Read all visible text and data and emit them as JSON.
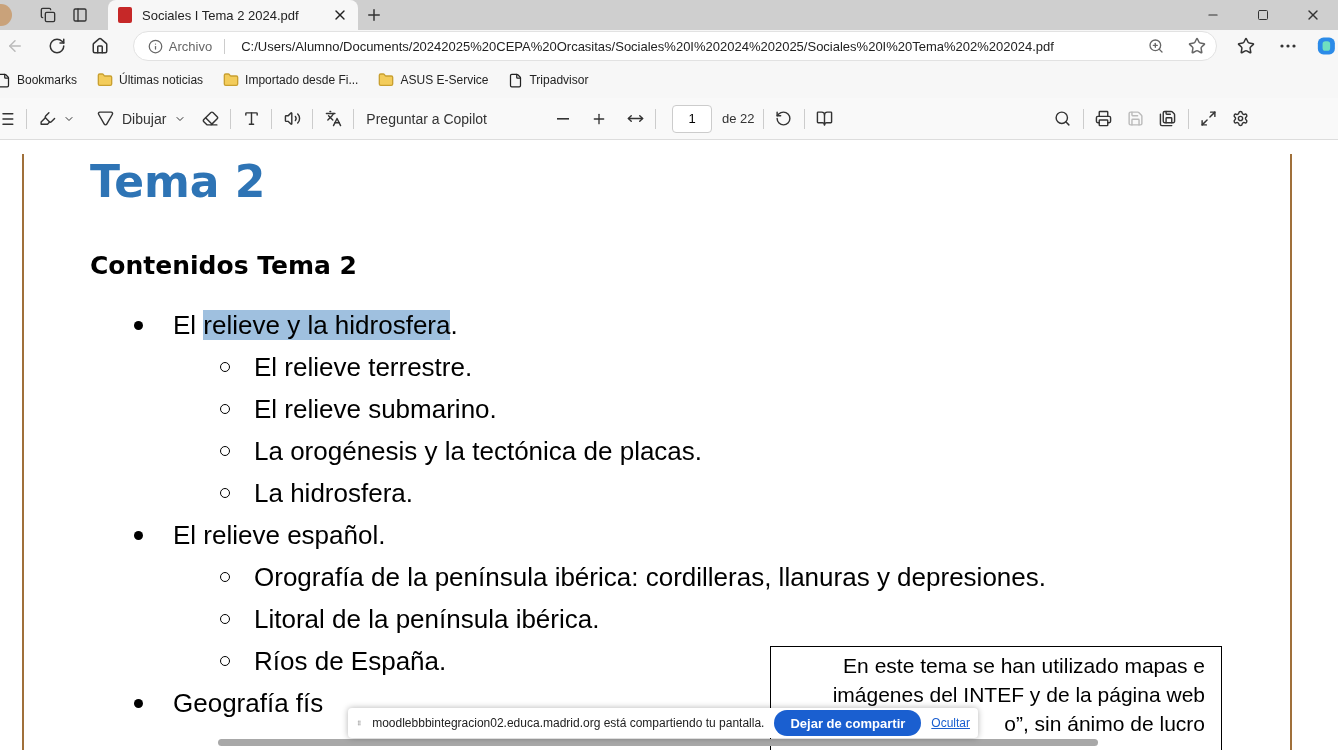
{
  "browser": {
    "tabs": [
      {
        "title": "Sociales I Tema 2 2024.pdf",
        "selected": true
      }
    ],
    "address": {
      "scheme_label": "Archivo",
      "url": "C:/Users/Alumno/Documents/20242025%20CEPA%20Orcasitas/Sociales%20I%202024%202025/Sociales%20I%20Tema%202%202024.pdf"
    },
    "bookmarks": [
      {
        "label": "Bookmarks",
        "kind": "page"
      },
      {
        "label": "Últimas noticias",
        "kind": "folder"
      },
      {
        "label": "Importado desde Fi...",
        "kind": "folder"
      },
      {
        "label": "ASUS E-Service",
        "kind": "folder"
      },
      {
        "label": "Tripadvisor",
        "kind": "page"
      }
    ]
  },
  "pdf_toolbar": {
    "draw_label": "Dibujar",
    "copilot_label": "Preguntar a Copilot",
    "page": "1",
    "page_count": "de 22"
  },
  "document": {
    "title": "Tema 2",
    "heading": "Contenidos Tema 2",
    "items": [
      {
        "segments": [
          {
            "text": "El ",
            "highlighted": false
          },
          {
            "text": "relieve y la hidrosfera",
            "highlighted": true
          },
          {
            "text": ".",
            "highlighted": false
          }
        ],
        "children": [
          {
            "text": "El relieve terrestre."
          },
          {
            "text": "El relieve submarino."
          },
          {
            "text": "La orogénesis y la tectónica de placas."
          },
          {
            "text": "La hidrosfera."
          }
        ]
      },
      {
        "text": "El relieve español.",
        "children": [
          {
            "text": "Orografía de la península ibérica: cordilleras, llanuras y depresiones."
          },
          {
            "text": "Litoral de la península ibérica."
          },
          {
            "text": "Ríos de España."
          }
        ]
      },
      {
        "text": "Geografía fís"
      }
    ],
    "note_lines": [
      "En este tema se han utilizado mapas e",
      "imágenes del INTEF y de la página web",
      "o”, sin ánimo de lucro"
    ]
  },
  "share_bar": {
    "message": "moodlebbbintegracion02.educa.madrid.org está compartiendo tu pantalla.",
    "stop_button": "Dejar de compartir",
    "hide_link": "Ocultar"
  }
}
